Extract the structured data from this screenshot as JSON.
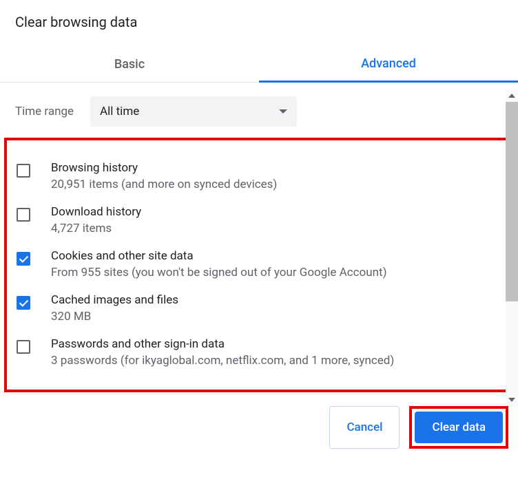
{
  "title": "Clear browsing data",
  "tabs": {
    "basic": "Basic",
    "advanced": "Advanced"
  },
  "time": {
    "label": "Time range",
    "value": "All time"
  },
  "items": [
    {
      "title": "Browsing history",
      "sub": "20,951 items (and more on synced devices)",
      "checked": false
    },
    {
      "title": "Download history",
      "sub": "4,727 items",
      "checked": false
    },
    {
      "title": "Cookies and other site data",
      "sub": "From 955 sites (you won't be signed out of your Google Account)",
      "checked": true
    },
    {
      "title": "Cached images and files",
      "sub": "320 MB",
      "checked": true
    },
    {
      "title": "Passwords and other sign-in data",
      "sub": "3 passwords (for ikyaglobal.com, netflix.com, and 1 more, synced)",
      "checked": false
    }
  ],
  "actions": {
    "cancel": "Cancel",
    "clear": "Clear data"
  }
}
